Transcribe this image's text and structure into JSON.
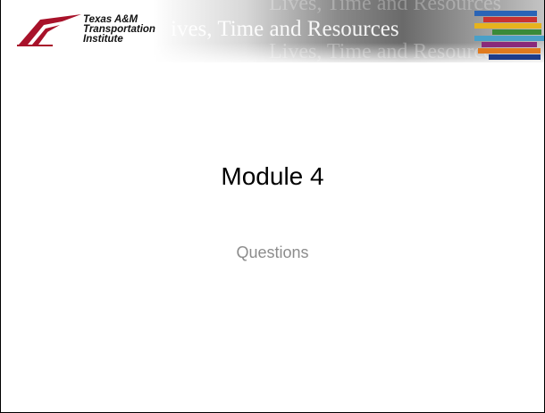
{
  "header": {
    "logo": {
      "line1": "Texas A&M",
      "line2": "Transportation",
      "line3": "Institute",
      "icon": "tti-road-logo-icon"
    },
    "motto": "Lives, Time and Resources",
    "motto_visible": "ives, Time and Resources"
  },
  "slide": {
    "title": "Module 4",
    "subtitle": "Questions"
  },
  "colors": {
    "logo_red": "#a8122a",
    "title": "#000000",
    "subtitle": "#8c8c8c",
    "stripe_colors": [
      "#2a64b6",
      "#c83232",
      "#e6b31e",
      "#3a8a3a",
      "#4aa0c8",
      "#8a2a7a",
      "#e07a1e",
      "#1e3c8a"
    ]
  }
}
